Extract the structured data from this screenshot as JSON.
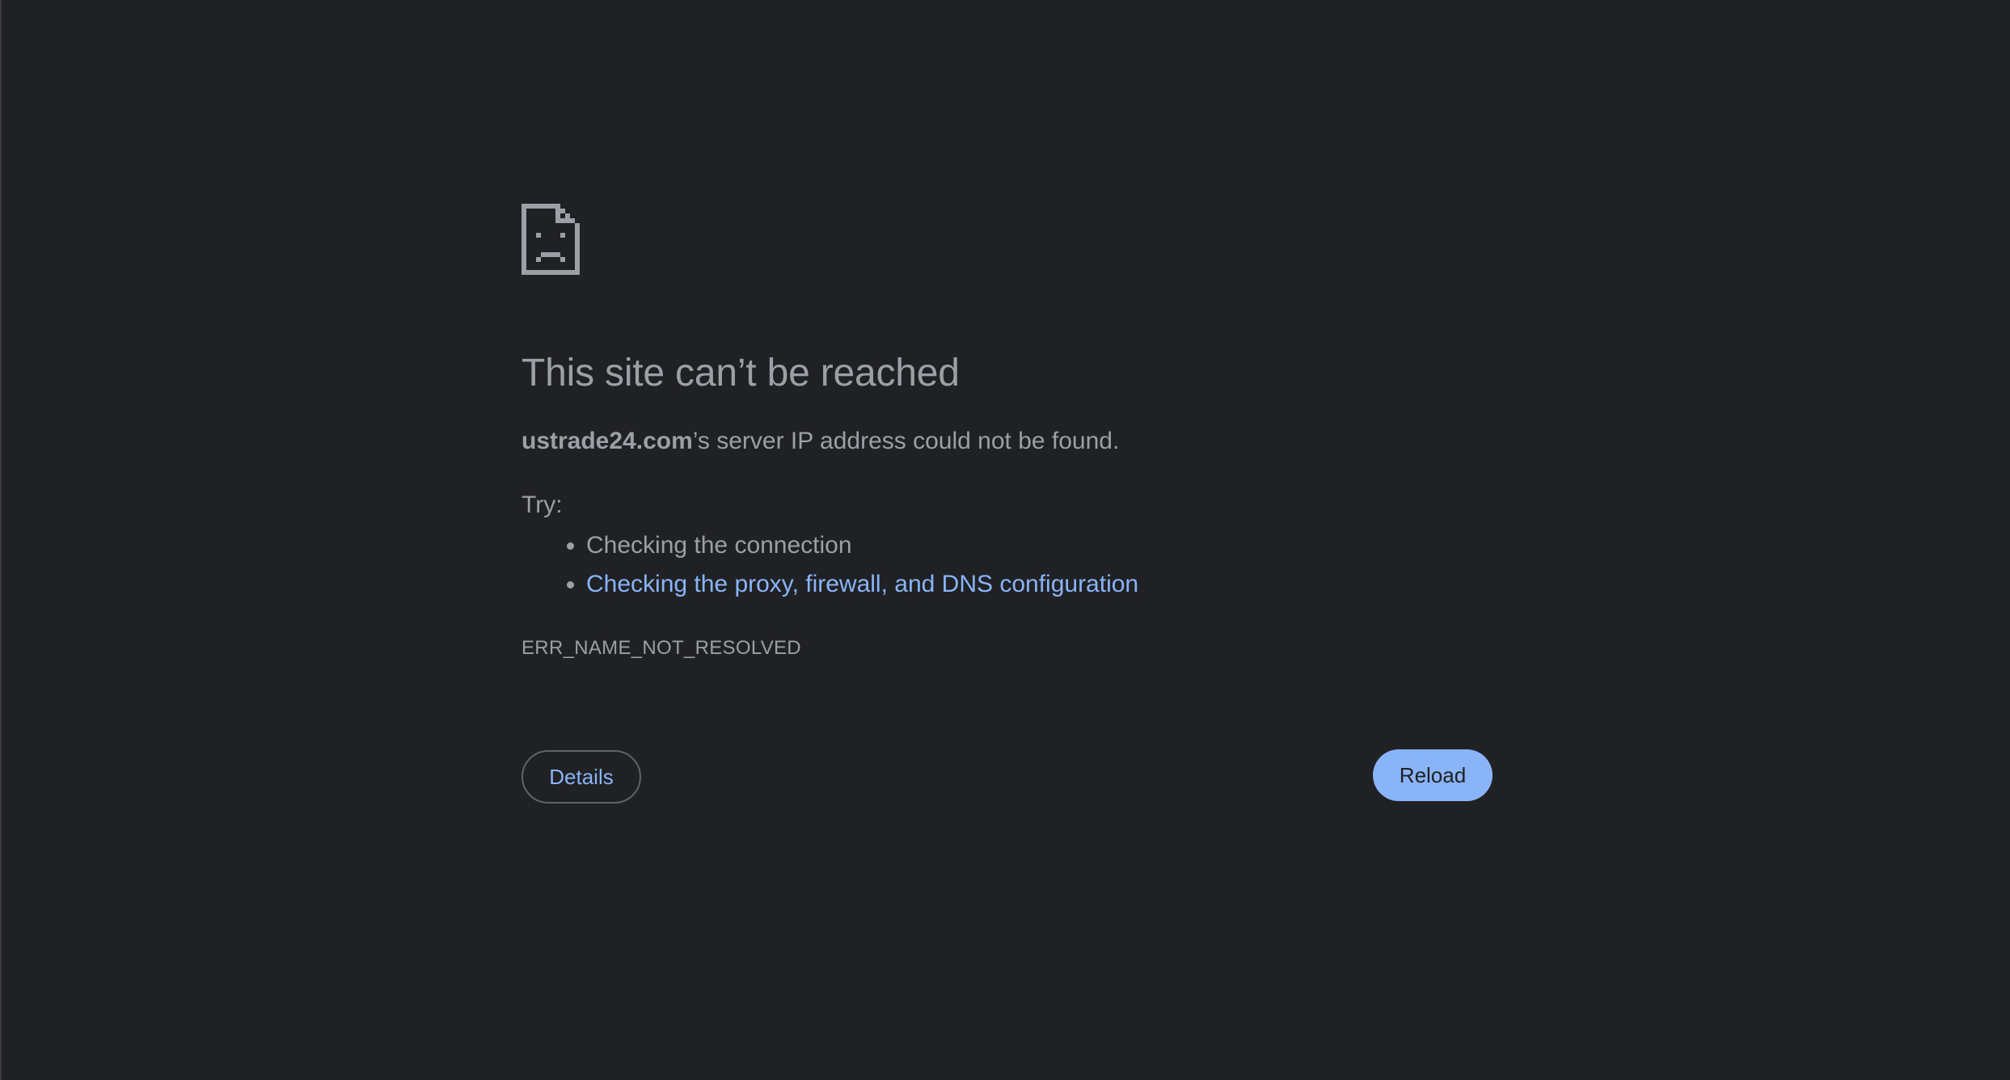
{
  "error": {
    "icon": "sad-page-icon",
    "title": "This site can’t be reached",
    "domain": "ustrade24.com",
    "summary_suffix": "’s server IP address could not be found.",
    "try_label": "Try:",
    "suggestions": [
      {
        "label": "Checking the connection",
        "link": false
      },
      {
        "label": "Checking the proxy, firewall, and DNS configuration",
        "link": true
      }
    ],
    "code": "ERR_NAME_NOT_RESOLVED"
  },
  "buttons": {
    "details_label": "Details",
    "reload_label": "Reload"
  },
  "colors": {
    "background": "#202124",
    "text": "#9aa0a6",
    "link": "#8ab4f8",
    "primary_button": "#8ab4f8"
  }
}
